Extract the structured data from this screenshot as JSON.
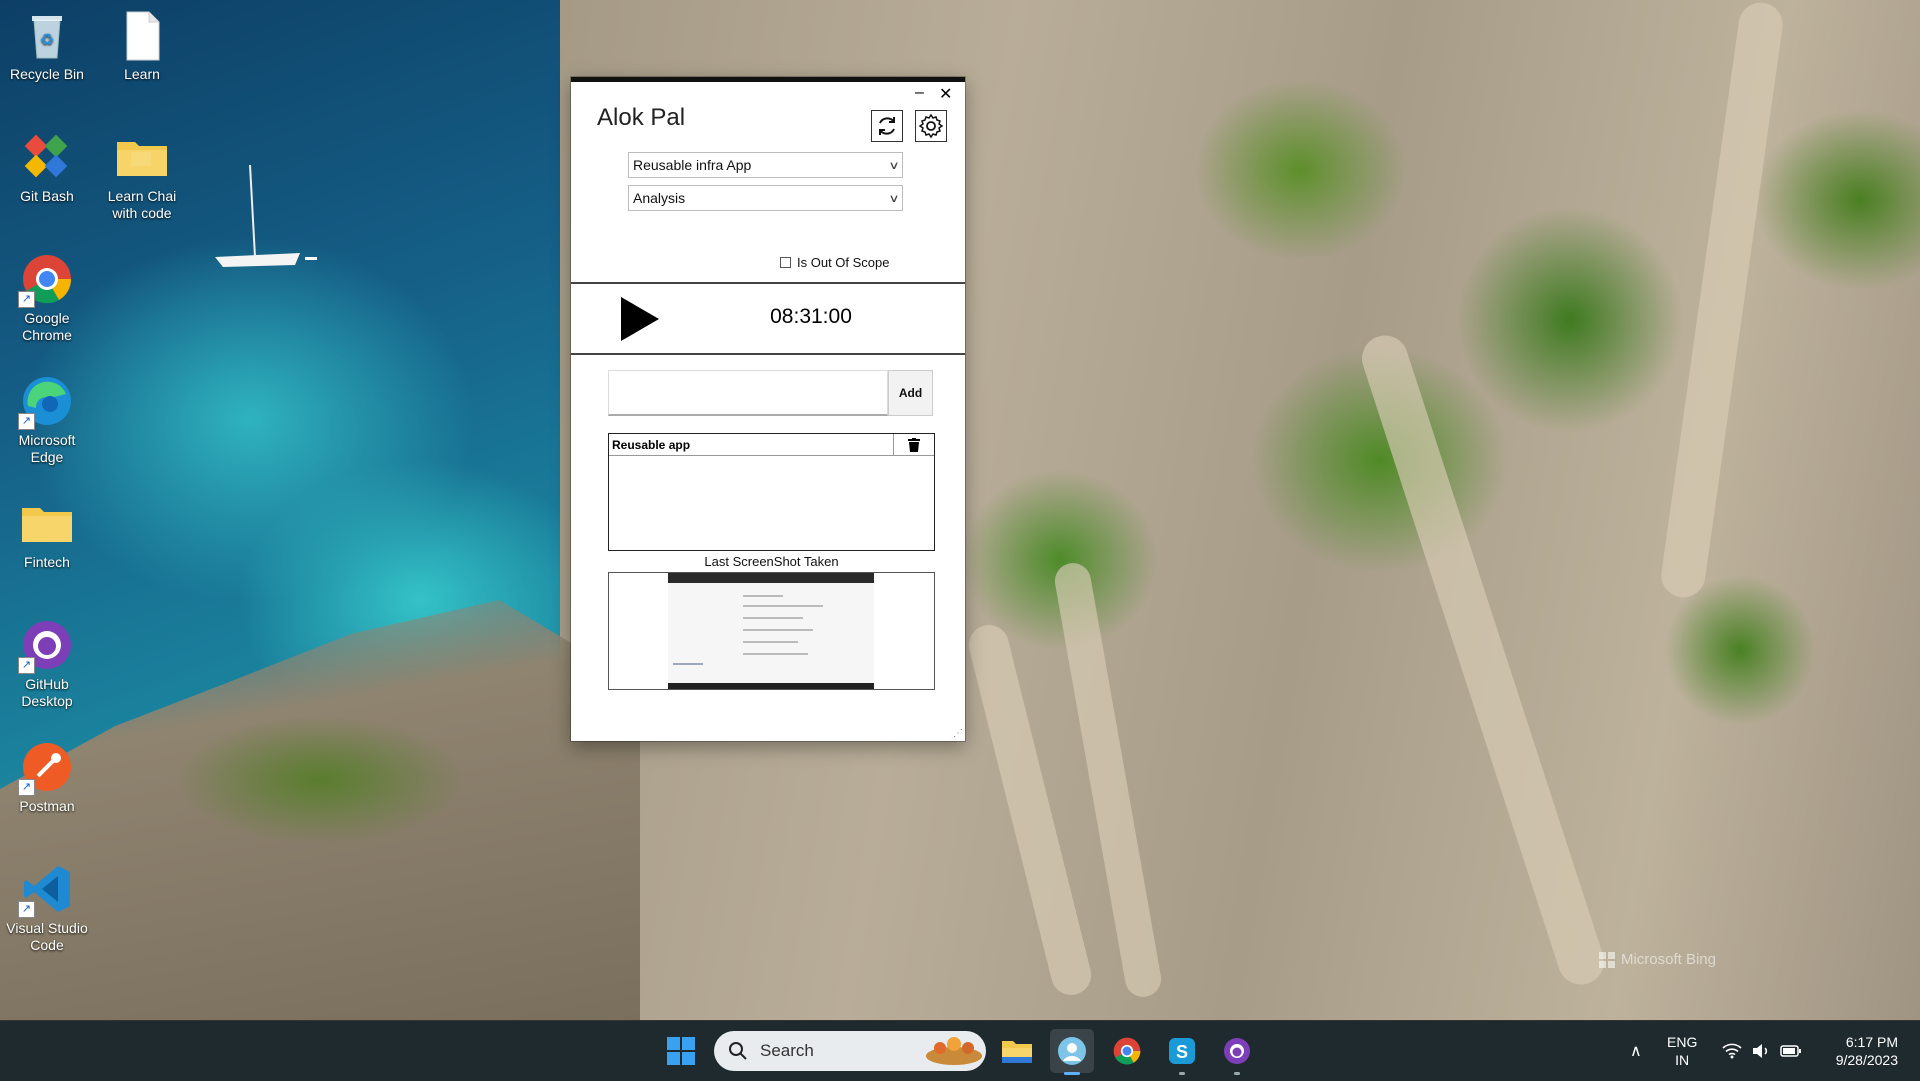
{
  "desktop": {
    "icons": [
      {
        "label": "Recycle Bin"
      },
      {
        "label": "Learn"
      },
      {
        "label": "Git Bash"
      },
      {
        "label": "Learn Chai with code"
      },
      {
        "label": "Google Chrome"
      },
      {
        "label": "Microsoft Edge"
      },
      {
        "label": "Fintech"
      },
      {
        "label": "GitHub Desktop"
      },
      {
        "label": "Postman"
      },
      {
        "label": "Visual Studio Code"
      }
    ],
    "watermark": "Microsoft Bing"
  },
  "app": {
    "user_name": "Alok Pal",
    "minimize_label": "–",
    "close_label": "✕",
    "project_select": {
      "value": "Reusable infra App"
    },
    "activity_select": {
      "value": "Analysis"
    },
    "out_of_scope_label": "Is Out Of Scope",
    "timer": "08:31:00",
    "add_button_label": "Add",
    "task_input_value": "",
    "tasks": [
      {
        "name": "Reusable app"
      }
    ],
    "screenshot_caption": "Last ScreenShot Taken"
  },
  "taskbar": {
    "search_placeholder": "Search",
    "language": "ENG",
    "region": "IN",
    "time": "6:17 PM",
    "date": "9/28/2023"
  },
  "colors": {
    "taskbar_bg": "#1f2a2e",
    "accent": "#5fb2ff"
  }
}
